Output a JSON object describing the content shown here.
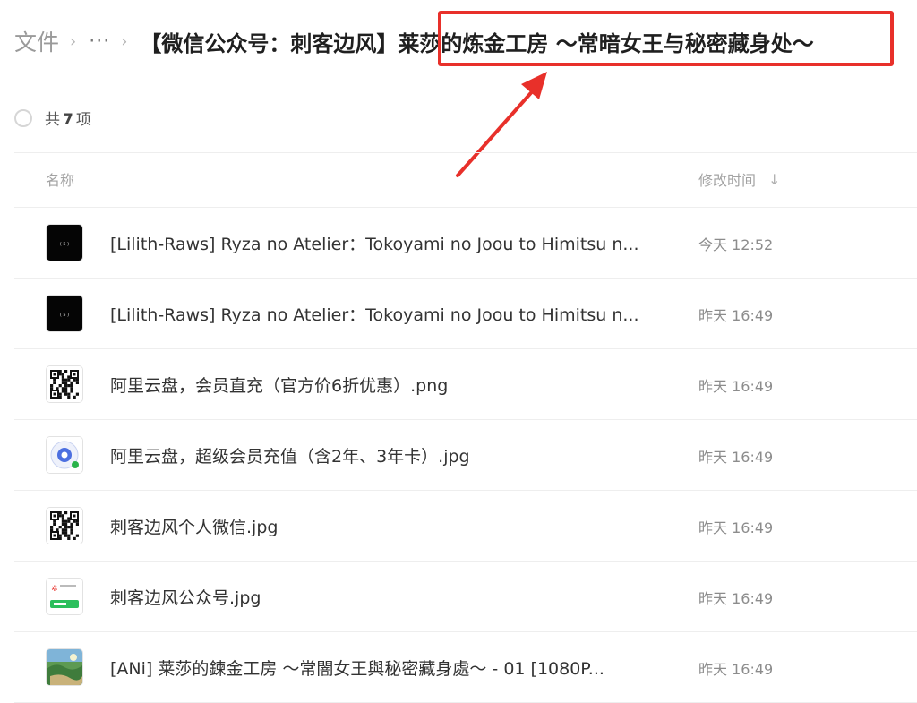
{
  "breadcrumb": {
    "root": "文件",
    "separator": "›",
    "ellipsis": "···",
    "current": "【微信公众号：刺客边风】莱莎的炼金工房 ～常暗女王与秘密藏身处～"
  },
  "annotation": {
    "highlight_color": "#e8302a"
  },
  "list_summary": {
    "prefix": "共",
    "count": "7",
    "suffix": "项"
  },
  "columns": {
    "name": "名称",
    "modified": "修改时间",
    "sort_icon": "arrow-down-icon"
  },
  "files": [
    {
      "name": "[Lilith-Raws] Ryza no Atelier：Tokoyami no Joou to Himitsu n...",
      "time": "今天 12:52",
      "thumb": "video-black"
    },
    {
      "name": "[Lilith-Raws] Ryza no Atelier：Tokoyami no Joou to Himitsu n...",
      "time": "昨天 16:49",
      "thumb": "video-black"
    },
    {
      "name": "阿里云盘，会员直充（官方价6折优惠）.png",
      "time": "昨天 16:49",
      "thumb": "qr"
    },
    {
      "name": "阿里云盘，超级会员充值（含2年、3年卡）.jpg",
      "time": "昨天 16:49",
      "thumb": "mini-program"
    },
    {
      "name": "刺客边风个人微信.jpg",
      "time": "昨天 16:49",
      "thumb": "qr"
    },
    {
      "name": "刺客边风公众号.jpg",
      "time": "昨天 16:49",
      "thumb": "wechat-card"
    },
    {
      "name": "[ANi] 莱莎的鍊金工房 ～常闇女王與秘密藏身處～ - 01 [1080P...",
      "time": "昨天 16:49",
      "thumb": "video-landscape"
    }
  ]
}
